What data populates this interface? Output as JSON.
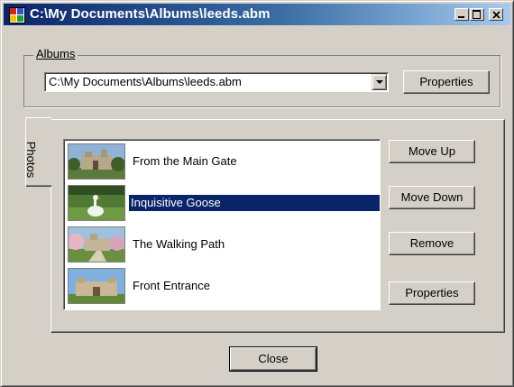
{
  "window": {
    "title": "C:\\My Documents\\Albums\\leeds.abm"
  },
  "albums": {
    "group_label": "Albums",
    "selected_value": "C:\\My Documents\\Albums\\leeds.abm",
    "properties_button": "Properties"
  },
  "tabs": [
    {
      "label": "Photos",
      "active": true
    }
  ],
  "photos": {
    "items": [
      {
        "label": "From the Main Gate",
        "thumbnail": "castle-gate-thumbnail",
        "selected": false
      },
      {
        "label": "Inquisitive Goose",
        "thumbnail": "goose-thumbnail",
        "selected": true
      },
      {
        "label": "The Walking Path",
        "thumbnail": "walking-path-thumbnail",
        "selected": false
      },
      {
        "label": "Front Entrance",
        "thumbnail": "front-entrance-thumbnail",
        "selected": false
      }
    ],
    "buttons": {
      "move_up": "Move Up",
      "move_down": "Move Down",
      "remove": "Remove",
      "properties": "Properties"
    }
  },
  "close_button": "Close",
  "colors": {
    "dialog_face": "#d4d0c8",
    "title_bar_start": "#0a246a",
    "title_bar_end": "#a6caf0",
    "selection": "#0a246a"
  }
}
